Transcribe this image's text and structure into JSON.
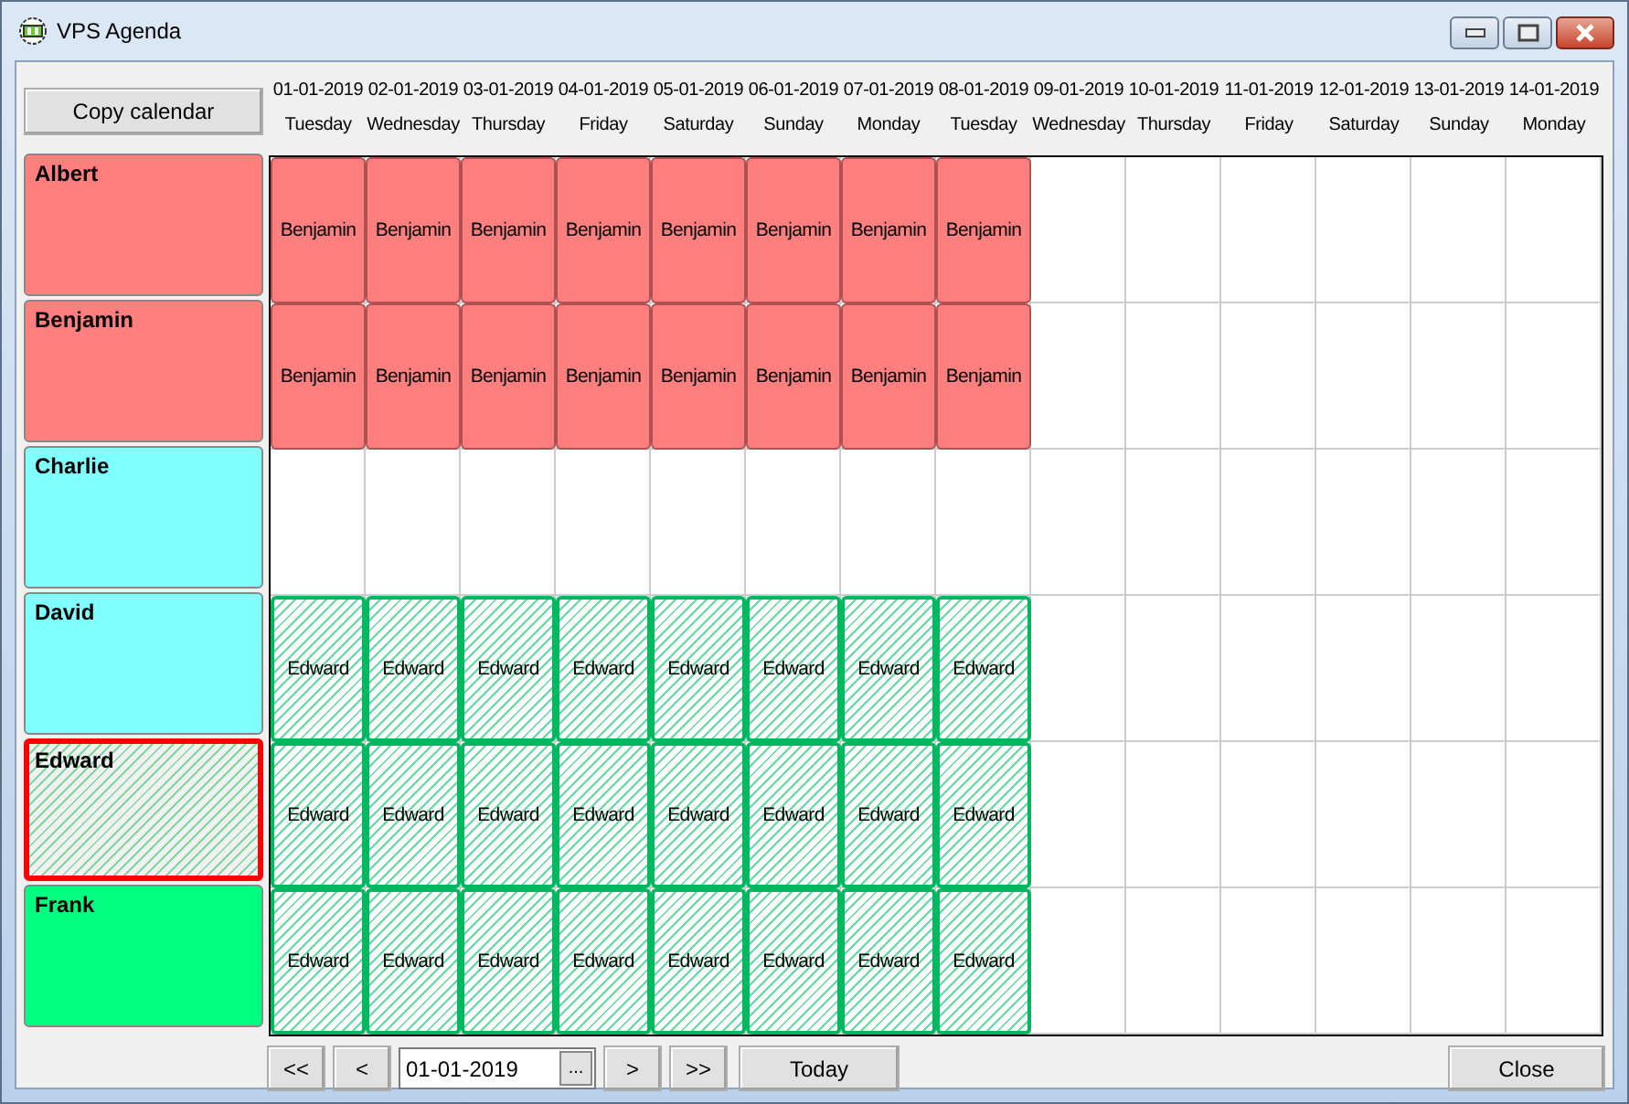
{
  "window": {
    "title": "VPS Agenda"
  },
  "copy_button": "Copy calendar",
  "days": [
    {
      "date": "01-01-2019",
      "weekday": "Tuesday"
    },
    {
      "date": "02-01-2019",
      "weekday": "Wednesday"
    },
    {
      "date": "03-01-2019",
      "weekday": "Thursday"
    },
    {
      "date": "04-01-2019",
      "weekday": "Friday"
    },
    {
      "date": "05-01-2019",
      "weekday": "Saturday"
    },
    {
      "date": "06-01-2019",
      "weekday": "Sunday"
    },
    {
      "date": "07-01-2019",
      "weekday": "Monday"
    },
    {
      "date": "08-01-2019",
      "weekday": "Tuesday"
    },
    {
      "date": "09-01-2019",
      "weekday": "Wednesday"
    },
    {
      "date": "10-01-2019",
      "weekday": "Thursday"
    },
    {
      "date": "11-01-2019",
      "weekday": "Friday"
    },
    {
      "date": "12-01-2019",
      "weekday": "Saturday"
    },
    {
      "date": "13-01-2019",
      "weekday": "Sunday"
    },
    {
      "date": "14-01-2019",
      "weekday": "Monday"
    }
  ],
  "resources": [
    {
      "name": "Albert",
      "kind": "solid",
      "color": "#ff7f7f",
      "selected": false,
      "bookings": [
        {
          "label": "Benjamin",
          "kind": "solid"
        },
        {
          "label": "Benjamin",
          "kind": "solid"
        },
        {
          "label": "Benjamin",
          "kind": "solid"
        },
        {
          "label": "Benjamin",
          "kind": "solid"
        },
        {
          "label": "Benjamin",
          "kind": "solid"
        },
        {
          "label": "Benjamin",
          "kind": "solid"
        },
        {
          "label": "Benjamin",
          "kind": "solid"
        },
        {
          "label": "Benjamin",
          "kind": "solid"
        }
      ]
    },
    {
      "name": "Benjamin",
      "kind": "solid",
      "color": "#ff7f7f",
      "selected": false,
      "bookings": [
        {
          "label": "Benjamin",
          "kind": "solid"
        },
        {
          "label": "Benjamin",
          "kind": "solid"
        },
        {
          "label": "Benjamin",
          "kind": "solid"
        },
        {
          "label": "Benjamin",
          "kind": "solid"
        },
        {
          "label": "Benjamin",
          "kind": "solid"
        },
        {
          "label": "Benjamin",
          "kind": "solid"
        },
        {
          "label": "Benjamin",
          "kind": "solid"
        },
        {
          "label": "Benjamin",
          "kind": "solid"
        }
      ]
    },
    {
      "name": "Charlie",
      "kind": "solid",
      "color": "#80ffff",
      "selected": false
    },
    {
      "name": "David",
      "kind": "solid",
      "color": "#80ffff",
      "selected": false,
      "bookings": [
        {
          "label": "Edward",
          "kind": "hatched"
        },
        {
          "label": "Edward",
          "kind": "hatched"
        },
        {
          "label": "Edward",
          "kind": "hatched"
        },
        {
          "label": "Edward",
          "kind": "hatched"
        },
        {
          "label": "Edward",
          "kind": "hatched"
        },
        {
          "label": "Edward",
          "kind": "hatched"
        },
        {
          "label": "Edward",
          "kind": "hatched"
        },
        {
          "label": "Edward",
          "kind": "hatched"
        }
      ]
    },
    {
      "name": "Edward",
      "kind": "hatched",
      "color": "#f0f0f0",
      "selected": true,
      "bookings": [
        {
          "label": "Edward",
          "kind": "hatched"
        },
        {
          "label": "Edward",
          "kind": "hatched"
        },
        {
          "label": "Edward",
          "kind": "hatched"
        },
        {
          "label": "Edward",
          "kind": "hatched"
        },
        {
          "label": "Edward",
          "kind": "hatched"
        },
        {
          "label": "Edward",
          "kind": "hatched"
        },
        {
          "label": "Edward",
          "kind": "hatched"
        },
        {
          "label": "Edward",
          "kind": "hatched"
        }
      ]
    },
    {
      "name": "Frank",
      "kind": "solid",
      "color": "#00ff80",
      "selected": false,
      "bookings": [
        {
          "label": "Edward",
          "kind": "hatched"
        },
        {
          "label": "Edward",
          "kind": "hatched"
        },
        {
          "label": "Edward",
          "kind": "hatched"
        },
        {
          "label": "Edward",
          "kind": "hatched"
        },
        {
          "label": "Edward",
          "kind": "hatched"
        },
        {
          "label": "Edward",
          "kind": "hatched"
        },
        {
          "label": "Edward",
          "kind": "hatched"
        },
        {
          "label": "Edward",
          "kind": "hatched"
        }
      ]
    }
  ],
  "nav": {
    "first": "<<",
    "prev": "<",
    "date": "01-01-2019",
    "picker": "...",
    "next": ">",
    "last": ">>",
    "today": "Today"
  },
  "close_button": "Close"
}
